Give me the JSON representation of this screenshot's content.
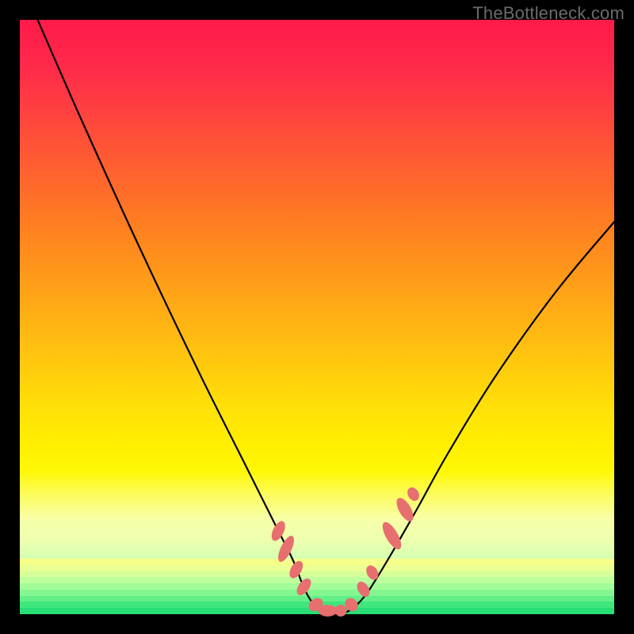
{
  "watermark": "TheBottleneck.com",
  "chart_data": {
    "type": "line",
    "title": "",
    "xlabel": "",
    "ylabel": "",
    "xlim": [
      0,
      100
    ],
    "ylim": [
      0,
      100
    ],
    "series": [
      {
        "name": "bottleneck-curve",
        "x": [
          3,
          10,
          20,
          30,
          38,
          43,
          46,
          48,
          50,
          52,
          54,
          56,
          58,
          60,
          63,
          67,
          72,
          80,
          90,
          100
        ],
        "y": [
          100,
          84,
          62,
          41,
          25,
          15,
          9,
          4,
          1,
          0,
          0,
          1,
          3,
          6,
          11,
          18,
          27,
          40,
          54,
          66
        ]
      }
    ],
    "markers": [
      {
        "name": "left-cluster",
        "cx": 43.5,
        "cy": 14.0,
        "rx": 0.9,
        "ry": 1.8,
        "rot": 26
      },
      {
        "name": "left-cluster-2",
        "cx": 44.8,
        "cy": 11.0,
        "rx": 0.9,
        "ry": 2.4,
        "rot": 26
      },
      {
        "name": "left-cluster-3",
        "cx": 46.5,
        "cy": 7.5,
        "rx": 0.9,
        "ry": 1.6,
        "rot": 30
      },
      {
        "name": "left-cluster-4",
        "cx": 47.8,
        "cy": 4.6,
        "rx": 0.9,
        "ry": 1.6,
        "rot": 36
      },
      {
        "name": "trough-1",
        "cx": 49.8,
        "cy": 1.6,
        "rx": 1.0,
        "ry": 1.3,
        "rot": 55
      },
      {
        "name": "trough-2",
        "cx": 51.8,
        "cy": 0.6,
        "rx": 1.6,
        "ry": 1.0,
        "rot": 0
      },
      {
        "name": "trough-3",
        "cx": 54.0,
        "cy": 0.6,
        "rx": 1.0,
        "ry": 1.0,
        "rot": 0
      },
      {
        "name": "trough-4",
        "cx": 55.8,
        "cy": 1.6,
        "rx": 1.0,
        "ry": 1.2,
        "rot": -40
      },
      {
        "name": "right-1",
        "cx": 57.8,
        "cy": 4.2,
        "rx": 0.9,
        "ry": 1.4,
        "rot": -32
      },
      {
        "name": "right-2",
        "cx": 59.3,
        "cy": 7.0,
        "rx": 0.9,
        "ry": 1.3,
        "rot": -30
      },
      {
        "name": "right-cluster",
        "cx": 62.6,
        "cy": 13.2,
        "rx": 1.0,
        "ry": 2.6,
        "rot": -30
      },
      {
        "name": "right-cluster-2",
        "cx": 64.8,
        "cy": 17.6,
        "rx": 1.0,
        "ry": 2.2,
        "rot": -30
      },
      {
        "name": "right-cluster-3",
        "cx": 66.2,
        "cy": 20.2,
        "rx": 0.9,
        "ry": 1.2,
        "rot": -30
      }
    ],
    "marker_color": "#e76f6f",
    "gradient_stops": [
      {
        "pos": 0,
        "color": "#ff1a4a"
      },
      {
        "pos": 50,
        "color": "#ffc000"
      },
      {
        "pos": 78,
        "color": "#fff000"
      },
      {
        "pos": 100,
        "color": "#2be477"
      }
    ]
  }
}
